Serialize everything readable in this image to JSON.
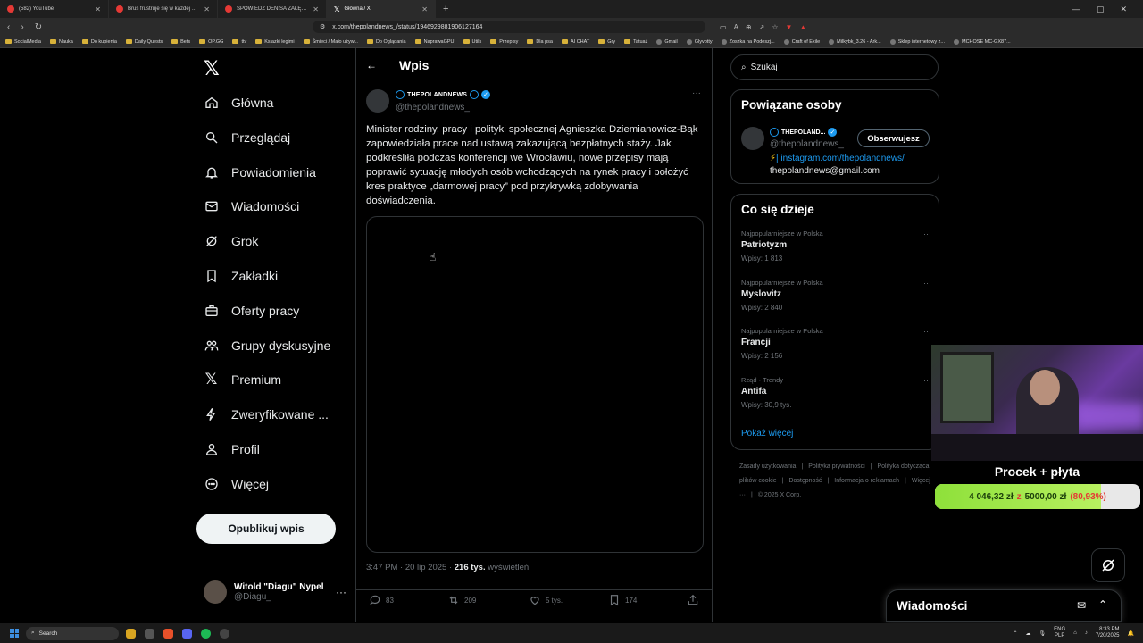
{
  "browser": {
    "tabs": [
      {
        "label": "(582) YouTube",
        "active": false
      },
      {
        "label": "Brus frustruje się w każdej grze... - Yo",
        "active": false
      },
      {
        "label": "SPOWIEDŹ DENISA ZAŁĘCKIEGO I SM",
        "active": false
      },
      {
        "label": "Główna / X",
        "active": true
      }
    ],
    "url": "x.com/thepolandnews_/status/1946929881906127164",
    "bookmarks": [
      "SocialMedia",
      "Nauka",
      "Do kupienia",
      "Daily Quests",
      "Bets",
      "OP.GG",
      "ttv",
      "Ksiazki legimi",
      "Śmieci / Mało używ...",
      "Do Oglądania",
      "NaprawaGPU",
      "Utils",
      "Przepisy",
      "Dla psa",
      "AI CHAT",
      "Gry",
      "Tatuaż",
      "Gmail",
      "Glyvotty",
      "Zoszka na Podeszj...",
      "Craft of Exile",
      "Milkybk_3.26 - Ark...",
      "Sklep internetowy z...",
      "MCHOSE MC-GX87..."
    ]
  },
  "nav": {
    "items": [
      {
        "label": "Główna",
        "icon": "home-icon"
      },
      {
        "label": "Przeglądaj",
        "icon": "search-icon"
      },
      {
        "label": "Powiadomienia",
        "icon": "bell-icon"
      },
      {
        "label": "Wiadomości",
        "icon": "mail-icon"
      },
      {
        "label": "Grok",
        "icon": "grok-icon"
      },
      {
        "label": "Zakładki",
        "icon": "bookmark-icon"
      },
      {
        "label": "Oferty pracy",
        "icon": "briefcase-icon"
      },
      {
        "label": "Grupy dyskusyjne",
        "icon": "people-icon"
      },
      {
        "label": "Premium",
        "icon": "x-icon"
      },
      {
        "label": "Zweryfikowane ...",
        "icon": "lightning-icon"
      },
      {
        "label": "Profil",
        "icon": "person-icon"
      },
      {
        "label": "Więcej",
        "icon": "more-circle-icon"
      }
    ],
    "publish_label": "Opublikuj wpis",
    "account": {
      "name": "Witold \"Diagu\" Nypel",
      "handle": "@Diagu_"
    }
  },
  "post": {
    "header_title": "Wpis",
    "author_name": "THEPOLANDNEWS",
    "author_handle": "@thepolandnews_",
    "text": "Minister rodziny, pracy i polityki społecznej Agnieszka Dziemianowicz-Bąk zapowiedziała prace nad ustawą zakazującą bezpłatnych staży. Jak podkreśliła podczas konferencji we Wrocławiu, nowe przepisy mają poprawić sytuację młodych osób wchodzących na rynek pracy i położyć kres praktyce „darmowej pracy” pod przykrywką zdobywania doświadczenia.",
    "time": "3:47 PM · 20 lip 2025 · ",
    "views_count": "216 tys.",
    "views_label": " wyświetleń",
    "replies": "83",
    "reposts": "209",
    "likes": "5 tys.",
    "bookmarks": "174"
  },
  "sidebar": {
    "search_placeholder": "Szukaj",
    "related_title": "Powiązane osoby",
    "related": {
      "name": "THEPOLAND...",
      "handle": "@thepolandnews_",
      "follow_label": "Obserwujesz",
      "bio_link": "instagram.com/thepolandnews/",
      "bio_mail": "thepolandnews@gmail.com"
    },
    "trends_title": "Co się dzieje",
    "trends": [
      {
        "category": "Najpopularniejsze w Polska",
        "name": "Patriotyzm",
        "count": "Wpisy: 1 813"
      },
      {
        "category": "Najpopularniejsze w Polska",
        "name": "Myslovitz",
        "count": "Wpisy: 2 840"
      },
      {
        "category": "Najpopularniejsze w Polska",
        "name": "Francji",
        "count": "Wpisy: 2 156"
      },
      {
        "category": "Rząd · Trendy",
        "name": "Antifa",
        "count": "Wpisy: 30,9 tys."
      }
    ],
    "show_more": "Pokaż więcej",
    "footer": [
      "Zasady użytkowania",
      "Polityka prywatności",
      "Polityka dotycząca plików cookie",
      "Dostępność",
      "Informacja o reklamach",
      "Więcej ···",
      "© 2025 X Corp."
    ]
  },
  "overlay": {
    "title": "Procek + płyta",
    "current": "4 046,32 zł",
    "separator": "z",
    "goal": "5000,00 zł",
    "percent": "(80,93%)",
    "progress_fraction": 0.8093
  },
  "messages_dock": {
    "title": "Wiadomości"
  },
  "taskbar": {
    "search_placeholder": "Search",
    "lang_top": "ENG",
    "lang_bottom": "PLP",
    "time": "8:33 PM",
    "date": "7/20/2025"
  },
  "colors": {
    "accent": "#1d9bf0",
    "background": "#000000",
    "progress": "#8ee03a"
  }
}
